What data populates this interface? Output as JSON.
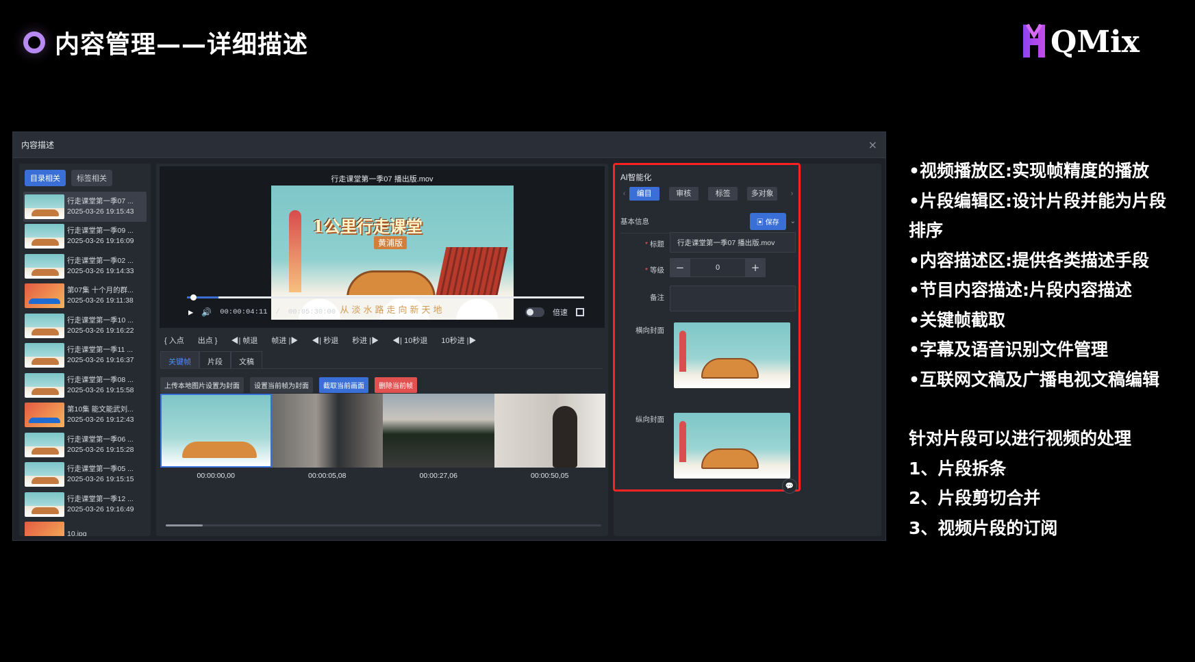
{
  "slide": {
    "title": "内容管理——详细描述",
    "logo_text": "QMix",
    "accent": "#b78af2"
  },
  "window": {
    "title": "内容描述",
    "close_icon": "×"
  },
  "left_panel": {
    "tabs": [
      "目录相关",
      "标签相关"
    ],
    "items": [
      {
        "title": "行走课堂第一季07 ...",
        "time": "2025-03-26 19:15:43"
      },
      {
        "title": "行走课堂第一季09 ...",
        "time": "2025-03-26 19:16:09"
      },
      {
        "title": "行走课堂第一季02 ...",
        "time": "2025-03-26 19:14:33"
      },
      {
        "title": "第07集 十个月的群...",
        "time": "2025-03-26 19:11:38"
      },
      {
        "title": "行走课堂第一季10 ...",
        "time": "2025-03-26 19:16:22"
      },
      {
        "title": "行走课堂第一季11 ...",
        "time": "2025-03-26 19:16:37"
      },
      {
        "title": "行走课堂第一季08 ...",
        "time": "2025-03-26 19:15:58"
      },
      {
        "title": "第10集 能文能武刘...",
        "time": "2025-03-26 19:12:43"
      },
      {
        "title": "行走课堂第一季06 ...",
        "time": "2025-03-26 19:15:28"
      },
      {
        "title": "行走课堂第一季05 ...",
        "time": "2025-03-26 19:15:15"
      },
      {
        "title": "行走课堂第一季12 ...",
        "time": "2025-03-26 19:16:49"
      },
      {
        "title": "10.jpg",
        "time": ""
      }
    ]
  },
  "player": {
    "file_name": "行走课堂第一季07 播出版.mov",
    "frame_title": "1公里行走课堂",
    "frame_subtitle": "黄浦版",
    "frame_caption": "从淡水路走向新天地",
    "time_current": "00:00:04:11",
    "time_separator": "/",
    "time_total": "00:05:30:00",
    "progress": 0.08,
    "speed_label": "倍速"
  },
  "jog_controls": [
    "入点",
    "出点",
    "帧退",
    "帧进",
    "秒退",
    "秒进",
    "10秒退",
    "10秒进"
  ],
  "content_tabs": [
    "关键帧",
    "片段",
    "文稿"
  ],
  "keyframe_buttons": [
    "上传本地图片设置为封面",
    "设置当前帧为封面",
    "截取当前画面",
    "删除当前帧"
  ],
  "keyframes": [
    "00:00:00,00",
    "00:00:05,08",
    "00:00:27,06",
    "00:00:50,05"
  ],
  "ai_panel": {
    "title": "AI智能化",
    "tabs": [
      "编目",
      "审核",
      "标签",
      "多对象"
    ],
    "section": "基本信息",
    "save_label": "保存",
    "title_label": "标题",
    "title_value": "行走课堂第一季07 播出版.mov",
    "level_label": "等级",
    "level_value": "0",
    "note_label": "备注",
    "h_cover_label": "横向封面",
    "v_cover_label": "纵向封面"
  },
  "notes": [
    "•视频播放区:实现帧精度的播放",
    "•片段编辑区:设计片段并能为片段排序",
    "•内容描述区:提供各类描述手段",
    "•节目内容描述:片段内容描述",
    "•关键帧截取",
    "•字幕及语音识别文件管理",
    "•互联网文稿及广播电视文稿编辑"
  ],
  "notes2": [
    "针对片段可以进行视频的处理",
    "1、片段拆条",
    "2、片段剪切合并",
    "3、视频片段的订阅"
  ]
}
